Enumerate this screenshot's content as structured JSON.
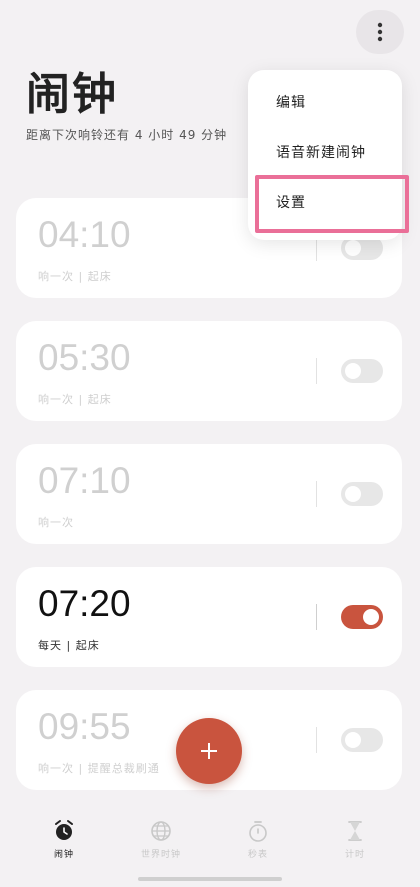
{
  "header": {
    "title": "闹钟",
    "next_alarm_text": "距离下次响铃还有 4 小时 49 分钟",
    "more_icon": "more-vertical-icon"
  },
  "menu": {
    "items": [
      {
        "label": "编辑"
      },
      {
        "label": "语音新建闹钟"
      },
      {
        "label": "设置"
      }
    ],
    "highlighted_item": "设置",
    "highlight_color": "#ea6f98"
  },
  "alarms": [
    {
      "time": "04:10",
      "desc": "响一次 | 起床",
      "enabled": false
    },
    {
      "time": "05:30",
      "desc": "响一次 | 起床",
      "enabled": false
    },
    {
      "time": "07:10",
      "desc": "响一次",
      "enabled": false
    },
    {
      "time": "07:20",
      "desc": "每天 | 起床",
      "enabled": true
    },
    {
      "time": "09:55",
      "desc": "响一次 | 提醒总裁刷通",
      "enabled": false
    }
  ],
  "fab": {
    "icon": "plus-icon",
    "color": "#c9543e"
  },
  "bottom_nav": {
    "items": [
      {
        "label": "闹钟",
        "icon": "alarm-clock-icon",
        "active": true
      },
      {
        "label": "世界时钟",
        "icon": "globe-icon",
        "active": false
      },
      {
        "label": "秒表",
        "icon": "stopwatch-icon",
        "active": false
      },
      {
        "label": "计时",
        "icon": "hourglass-icon",
        "active": false
      }
    ]
  },
  "colors": {
    "accent": "#c9543e",
    "background": "#f3f1f3"
  }
}
